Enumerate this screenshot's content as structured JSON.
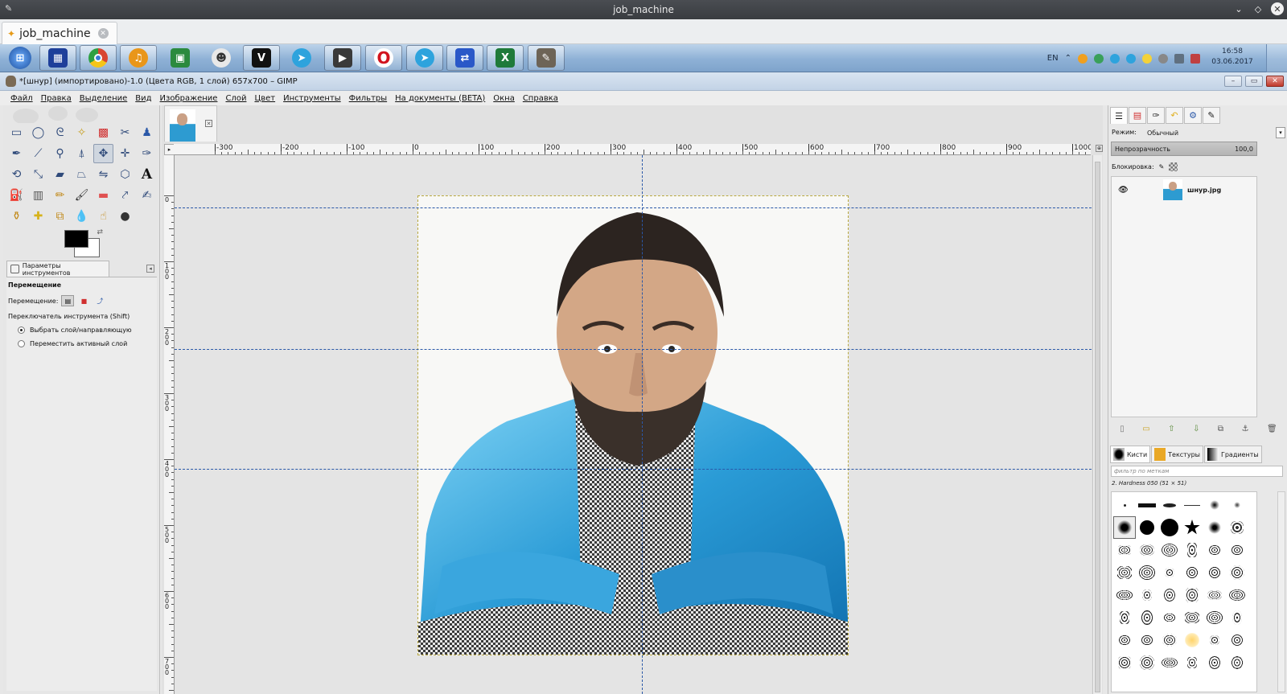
{
  "outer_window": {
    "title": "job_machine"
  },
  "session_tab": {
    "label": "job_machine"
  },
  "taskbar": {
    "language": "EN",
    "clock_time": "16:58",
    "clock_date": "03.06.2017",
    "apps": [
      {
        "name": "start-orb",
        "color": "#2a6fbf",
        "glyph": "⊞"
      },
      {
        "name": "app-blue-grid",
        "color": "#1e3f9a",
        "glyph": "▦"
      },
      {
        "name": "chrome-icon",
        "color": "#d84532",
        "glyph": "◉"
      },
      {
        "name": "app-orange",
        "color": "#e9961a",
        "glyph": "♫"
      },
      {
        "name": "remote-desktop-icon",
        "color": "#2b8a3e",
        "glyph": "▣"
      },
      {
        "name": "alien-icon",
        "color": "#dcdcdc",
        "glyph": "☻"
      },
      {
        "name": "vivaldi-icon",
        "color": "#111111",
        "glyph": "V"
      },
      {
        "name": "telegram-icon",
        "color": "#2ea3dd",
        "glyph": "➤"
      },
      {
        "name": "media-player-icon",
        "color": "#3a3a3a",
        "glyph": "▶"
      },
      {
        "name": "opera-icon",
        "color": "#d2141f",
        "glyph": "O"
      },
      {
        "name": "telegram-icon-2",
        "color": "#2ea3dd",
        "glyph": "➤"
      },
      {
        "name": "network-icon",
        "color": "#2a58c8",
        "glyph": "⇄"
      },
      {
        "name": "excel-icon",
        "color": "#1f7a3a",
        "glyph": "X"
      },
      {
        "name": "gimp-icon",
        "color": "#6d6457",
        "glyph": "✎"
      }
    ]
  },
  "gimp": {
    "title": "*[шнур] (импортировано)-1.0 (Цвета RGB, 1 слой) 657x700 – GIMP",
    "menu": [
      "Файл",
      "Правка",
      "Выделение",
      "Вид",
      "Изображение",
      "Слой",
      "Цвет",
      "Инструменты",
      "Фильтры",
      "На документы (BETA)",
      "Окна",
      "Справка"
    ],
    "tool_options": {
      "tab_label": "Параметры инструментов",
      "heading": "Перемещение",
      "move_label": "Перемещение:",
      "switch_label": "Переключатель инструмента  (Shift)",
      "radio_1": "Выбрать слой/направляющую",
      "radio_2": "Переместить активный слой"
    },
    "ruler_h_labels": [
      "|-300",
      "|-200",
      "|-100",
      "|0",
      "|100",
      "|200",
      "|300",
      "|400",
      "|500",
      "|600",
      "|700",
      "|800",
      "|900",
      "|1000"
    ],
    "ruler_v_labels": [
      "0",
      "100",
      "200",
      "300",
      "400",
      "500",
      "600",
      "700"
    ],
    "layers": {
      "mode_label": "Режим:",
      "mode_value": "Обычный",
      "opacity_label": "Непрозрачность",
      "opacity_value": "100,0",
      "lock_label": "Блокировка:",
      "layer_name": "шнур.jpg"
    },
    "brushes": {
      "tab_brushes": "Кисти",
      "tab_patterns": "Текстуры",
      "tab_gradients": "Градиенты",
      "filter_placeholder": "фильтр по меткам",
      "current_brush": "2. Hardness 050 (51 × 51)"
    }
  }
}
